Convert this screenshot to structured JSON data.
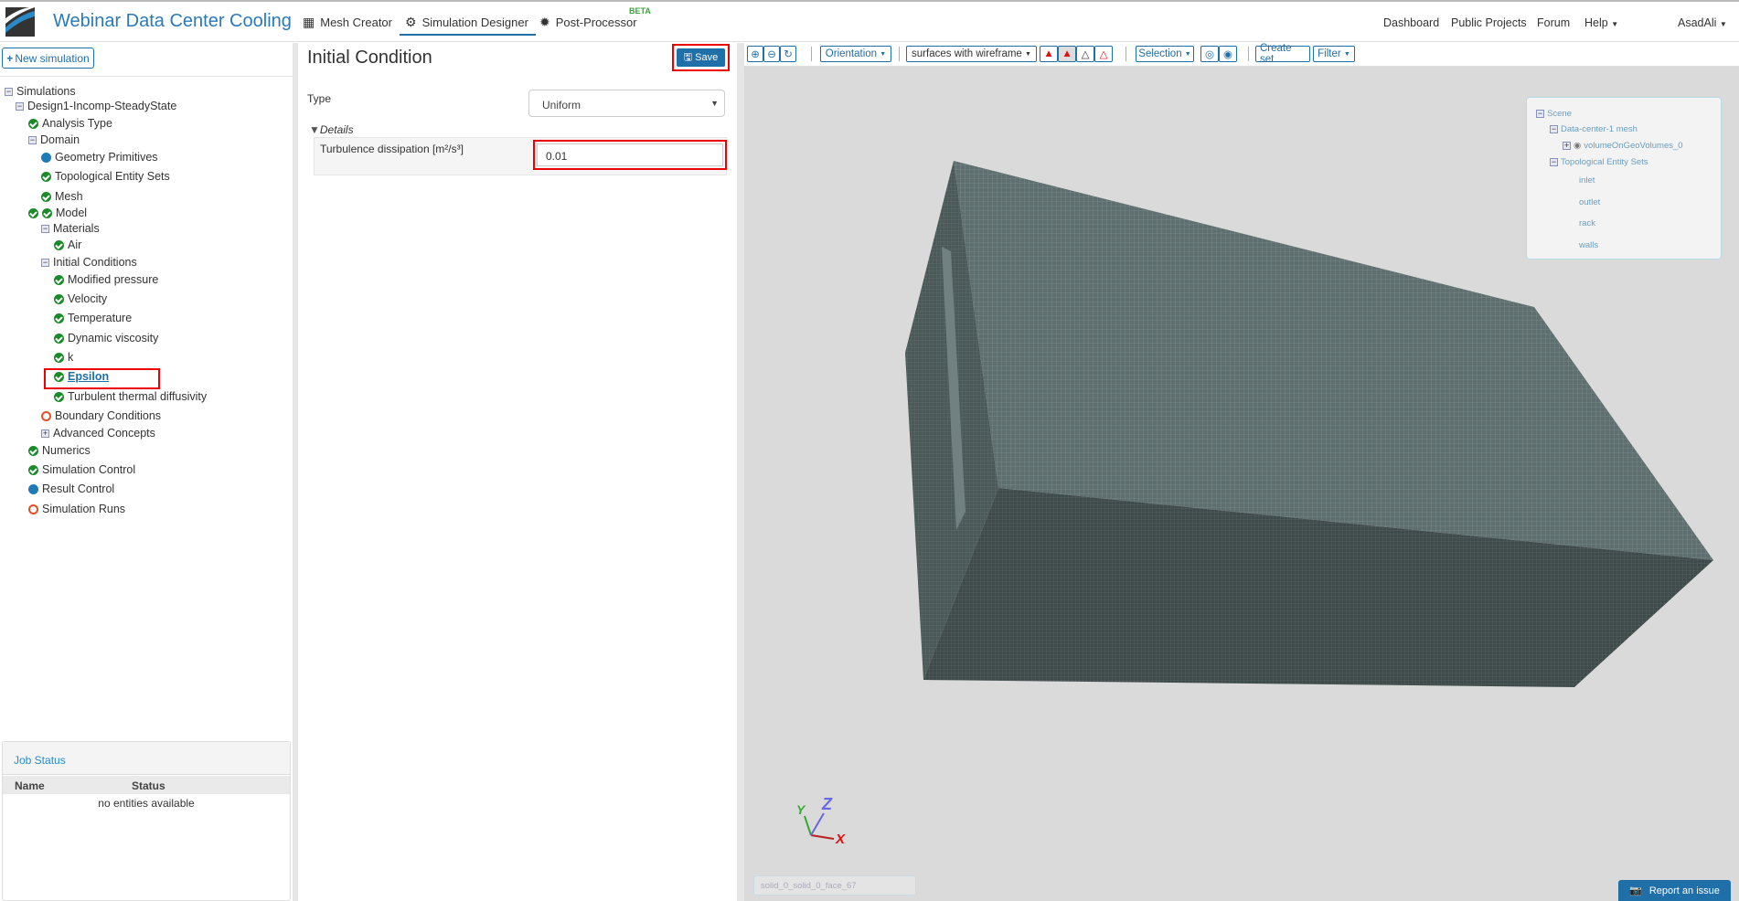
{
  "header": {
    "app_title": "Webinar Data Center Cooling",
    "nav": [
      "Mesh Creator",
      "Simulation Designer",
      "Post-Processor"
    ],
    "beta": "BETA",
    "right_nav": [
      "Dashboard",
      "Public Projects",
      "Forum",
      "Help"
    ],
    "user": "AsadAli"
  },
  "sidebar": {
    "new_simulation": "New simulation",
    "tree": [
      {
        "label": "Simulations",
        "status": "toggle-minus"
      },
      {
        "label": "Design1-Incomp-SteadyState",
        "status": "toggle-minus"
      },
      {
        "label": "Analysis Type",
        "status": "ok"
      },
      {
        "label": "Domain",
        "status": "toggle-minus"
      },
      {
        "label": "Geometry Primitives",
        "status": "blue"
      },
      {
        "label": "Topological Entity Sets",
        "status": "ok"
      },
      {
        "label": "Mesh",
        "status": "ok"
      },
      {
        "label": "Model",
        "status": "ok"
      },
      {
        "label": "Materials",
        "status": "toggle-minus"
      },
      {
        "label": "Air",
        "status": "ok"
      },
      {
        "label": "Initial Conditions",
        "status": "toggle-minus"
      },
      {
        "label": "Modified pressure",
        "status": "ok"
      },
      {
        "label": "Velocity",
        "status": "ok"
      },
      {
        "label": "Temperature",
        "status": "ok"
      },
      {
        "label": "Dynamic viscosity",
        "status": "ok"
      },
      {
        "label": "k",
        "status": "ok"
      },
      {
        "label": "Epsilon",
        "status": "ok"
      },
      {
        "label": "Turbulent thermal diffusivity",
        "status": "ok"
      },
      {
        "label": "Boundary Conditions",
        "status": "empty"
      },
      {
        "label": "Advanced Concepts",
        "status": "toggle-plus"
      },
      {
        "label": "Numerics",
        "status": "ok"
      },
      {
        "label": "Simulation Control",
        "status": "ok"
      },
      {
        "label": "Result Control",
        "status": "blue"
      },
      {
        "label": "Simulation Runs",
        "status": "empty"
      }
    ],
    "job_status": {
      "title": "Job Status",
      "columns": [
        "Name",
        "Status"
      ],
      "empty": "no entities available"
    }
  },
  "editor": {
    "title": "Initial Condition",
    "save": "Save",
    "type_label": "Type",
    "type_value": "Uniform",
    "details": "Details",
    "field_label": "Turbulence dissipation [m²/s³]",
    "field_value": "0.01"
  },
  "viewer": {
    "toolbar": {
      "orientation": "Orientation",
      "render_mode": "surfaces with wireframe",
      "selection": "Selection",
      "create_set": "Create set",
      "filter": "Filter"
    },
    "scene": {
      "root": "Scene",
      "mesh": "Data-center-1 mesh",
      "volume": "volumeOnGeoVolumes_0",
      "sets_title": "Topological Entity Sets",
      "sets": [
        "inlet",
        "outlet",
        "rack",
        "walls"
      ]
    },
    "axes": [
      "X",
      "Y",
      "Z"
    ],
    "face_label": "solid_0_solid_0_face_67",
    "report": "Report an issue",
    "colors": {
      "accent": "#1f6fa8",
      "mesh_top": "#5f6f6f",
      "mesh_front": "#3f4b4b"
    }
  }
}
